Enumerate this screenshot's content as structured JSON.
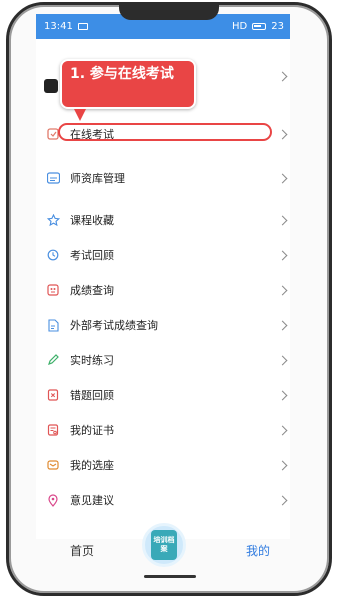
{
  "status_bar": {
    "time": "13:41",
    "right_text": "HD",
    "battery": "23"
  },
  "callout": {
    "text": "1. 参与在线考试"
  },
  "menu": [
    {
      "label": "在线考试",
      "icon": "exam-online-icon",
      "color": "#e07a6a"
    },
    {
      "label": "师资库管理",
      "icon": "teacher-database-icon",
      "color": "#4a8fe0"
    },
    {
      "label": "课程收藏",
      "icon": "star-icon",
      "color": "#4a8fe0"
    },
    {
      "label": "考试回顾",
      "icon": "history-icon",
      "color": "#4a8fe0"
    },
    {
      "label": "成绩查询",
      "icon": "score-query-icon",
      "color": "#e05555"
    },
    {
      "label": "外部考试成绩查询",
      "icon": "external-score-icon",
      "color": "#4a8fe0"
    },
    {
      "label": "实时练习",
      "icon": "pencil-icon",
      "color": "#3fb06a"
    },
    {
      "label": "错题回顾",
      "icon": "wrong-question-icon",
      "color": "#e05555"
    },
    {
      "label": "我的证书",
      "icon": "certificate-icon",
      "color": "#e05555"
    },
    {
      "label": "我的选座",
      "icon": "seat-icon",
      "color": "#e08a30"
    },
    {
      "label": "意见建议",
      "icon": "location-feedback-icon",
      "color": "#d9468a"
    }
  ],
  "bottom_nav": {
    "home": "首页",
    "center_badge": "培训档案",
    "mine": "我的"
  },
  "colors": {
    "status_bar": "#3d8ee6",
    "accent": "#2f7be0",
    "callout": "#e94545"
  }
}
